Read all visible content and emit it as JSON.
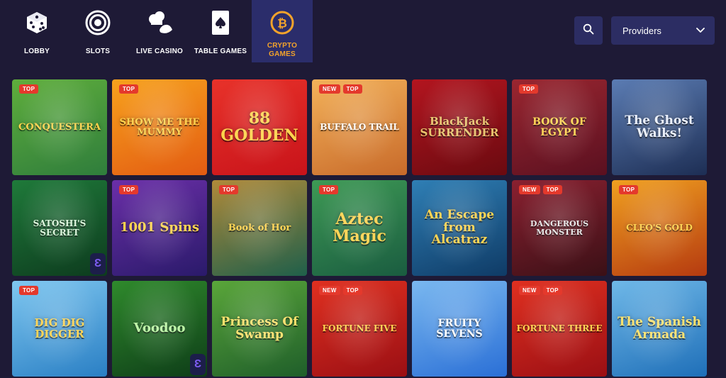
{
  "nav": {
    "items": [
      {
        "label": "LOBBY",
        "icon": "dice-icon"
      },
      {
        "label": "SLOTS",
        "icon": "target-icon"
      },
      {
        "label": "LIVE CASINO",
        "icon": "chef-hat-icon"
      },
      {
        "label": "TABLE GAMES",
        "icon": "playing-card-icon"
      },
      {
        "label": "CRYPTO GAMES",
        "icon": "bitcoin-icon",
        "active": true
      }
    ],
    "accent_color": "#f3a32b"
  },
  "search": {
    "icon": "search-icon"
  },
  "providers": {
    "label": "Providers",
    "icon": "chevron-down-icon"
  },
  "badges": {
    "top": "TOP",
    "new": "NEW"
  },
  "games": [
    {
      "name": "CONQUESTERA",
      "badges": [
        "TOP"
      ],
      "colors": [
        "#2f7d3c",
        "#5fae3c"
      ]
    },
    {
      "name": "SHOW ME THE MUMMY",
      "badges": [
        "TOP"
      ],
      "colors": [
        "#e35b12",
        "#f7a21d"
      ]
    },
    {
      "name": "88 GOLDEN",
      "badges": [],
      "colors": [
        "#c8131a",
        "#e8322a"
      ]
    },
    {
      "name": "BUFFALO TRAIL",
      "badges": [
        "NEW",
        "TOP"
      ],
      "colors": [
        "#c86a2a",
        "#f3b25a"
      ]
    },
    {
      "name": "BlackJack SURRENDER",
      "badges": [],
      "colors": [
        "#6a0a10",
        "#b3151f"
      ]
    },
    {
      "name": "BOOK OF EGYPT",
      "badges": [
        "TOP"
      ],
      "colors": [
        "#5a1020",
        "#9a2630"
      ]
    },
    {
      "name": "The Ghost Walks!",
      "badges": [],
      "colors": [
        "#1d2e54",
        "#5b7cb3"
      ]
    },
    {
      "name": "SATOSHI'S SECRET",
      "badges": [],
      "colors": [
        "#0d3b1e",
        "#1f7a3a"
      ],
      "provider_logo": true
    },
    {
      "name": "1001 Spins",
      "badges": [
        "TOP"
      ],
      "colors": [
        "#2a1a6a",
        "#6b2fa8"
      ]
    },
    {
      "name": "Book of Hor",
      "badges": [
        "TOP"
      ],
      "colors": [
        "#1f5f4a",
        "#b08a3a"
      ]
    },
    {
      "name": "Aztec Magic",
      "badges": [
        "TOP"
      ],
      "colors": [
        "#1a5c40",
        "#3e9a55"
      ]
    },
    {
      "name": "An Escape from Alcatraz",
      "badges": [],
      "colors": [
        "#0f3b66",
        "#2f7fb5"
      ]
    },
    {
      "name": "DANGEROUS MONSTER",
      "badges": [
        "NEW",
        "TOP"
      ],
      "colors": [
        "#3a1016",
        "#8a2030"
      ]
    },
    {
      "name": "CLEO'S GOLD",
      "badges": [
        "TOP"
      ],
      "colors": [
        "#b53a10",
        "#f0a020"
      ]
    },
    {
      "name": "DIG DIG DIGGER",
      "badges": [
        "TOP"
      ],
      "colors": [
        "#2a7fc4",
        "#7fc7f0"
      ]
    },
    {
      "name": "Voodoo",
      "badges": [],
      "colors": [
        "#0e3d18",
        "#2f8a2c"
      ],
      "provider_logo": true
    },
    {
      "name": "Princess Of Swamp",
      "badges": [],
      "colors": [
        "#1f5e2a",
        "#5aa63a"
      ]
    },
    {
      "name": "FORTUNE FIVE",
      "badges": [
        "NEW",
        "TOP"
      ],
      "colors": [
        "#9a0f14",
        "#e03020"
      ]
    },
    {
      "name": "FRUITY SEVENS",
      "badges": [],
      "colors": [
        "#2a6fd6",
        "#7ab8f0"
      ]
    },
    {
      "name": "FORTUNE THREE",
      "badges": [
        "NEW",
        "TOP"
      ],
      "colors": [
        "#9a0f14",
        "#e03020"
      ]
    },
    {
      "name": "The Spanish Armada",
      "badges": [],
      "colors": [
        "#1f6fb8",
        "#6fb8e8"
      ]
    }
  ]
}
